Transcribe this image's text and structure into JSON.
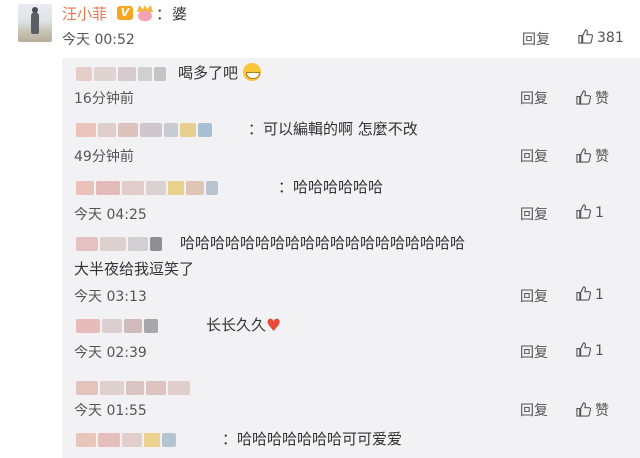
{
  "colors": {
    "username": "#eb7350",
    "panel_bg": "#f2f2f5",
    "text": "#333333",
    "meta": "#555555",
    "heart": "#e64b3c"
  },
  "icons": {
    "like": "thumbs-up-icon",
    "verified": "v-badge-icon",
    "vip": "vip-crown-icon"
  },
  "main_comment": {
    "username": "汪小菲",
    "colon": "：",
    "text": "婆",
    "time": "今天 00:52",
    "reply_label": "回复",
    "like_count": "381"
  },
  "replies": [
    {
      "text": "喝多了吧",
      "time": "16分钟前",
      "reply_label": "回复",
      "like_label": "赞",
      "emoji": "grin"
    },
    {
      "text": "：可以編輯的啊 怎麼不改",
      "time": "49分钟前",
      "reply_label": "回复",
      "like_label": "赞"
    },
    {
      "text": "：哈哈哈哈哈哈",
      "time": "今天 04:25",
      "reply_label": "回复",
      "like_label": "1"
    },
    {
      "text_line1": "哈哈哈哈哈哈哈哈哈哈哈哈哈哈哈哈哈哈哈",
      "text_line2": "大半夜给我逗笑了",
      "time": "今天 03:13",
      "reply_label": "回复",
      "like_label": "1"
    },
    {
      "text": "长长久久",
      "time": "今天 02:39",
      "reply_label": "回复",
      "like_label": "1",
      "emoji": "heart"
    },
    {
      "text": "",
      "time": "今天 01:55",
      "reply_label": "回复",
      "like_label": "赞"
    },
    {
      "text": "：哈哈哈哈哈哈哈可可爱爱",
      "time": "",
      "reply_label": "",
      "like_label": ""
    }
  ]
}
